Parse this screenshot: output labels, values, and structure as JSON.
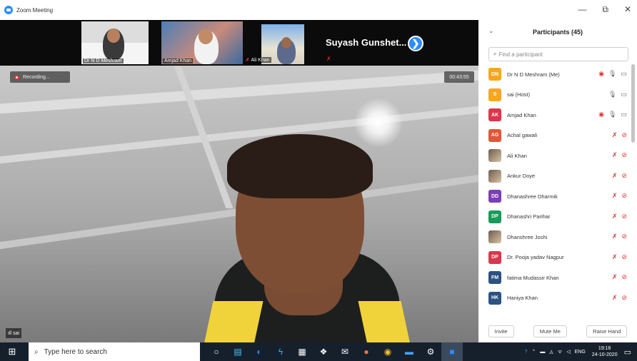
{
  "window": {
    "title": "Zoom Meeting",
    "controls": [
      "—",
      "⧉",
      "✕"
    ]
  },
  "thumbnails": [
    {
      "name": "Dr N D Meshram"
    },
    {
      "name": "Amjad Khan"
    },
    {
      "name": "Ali Khan"
    }
  ],
  "next_participant": "Suyash Gunshet...",
  "next_arrow": "❯",
  "recording": {
    "label": "Recording..."
  },
  "timer": "00:43:55",
  "active_speaker": {
    "name": "sai"
  },
  "panel": {
    "title": "Participants (45)",
    "search_placeholder": "Find a participant",
    "participants": [
      {
        "initials": "DN",
        "color": "#f5a623",
        "name": "Dr N D Meshram (Me)",
        "status": "rec-unmuted"
      },
      {
        "initials": "S",
        "color": "#f5a623",
        "name": "sai (Host)",
        "status": "unmuted"
      },
      {
        "initials": "AK",
        "color": "#d9374b",
        "name": "Amjad Khan",
        "status": "rec-unmuted"
      },
      {
        "initials": "AG",
        "color": "#e5553a",
        "name": "Achal gawali",
        "status": "muted"
      },
      {
        "initials": "",
        "color": "",
        "name": "Ali Khan",
        "status": "muted"
      },
      {
        "initials": "",
        "color": "",
        "name": "Ankur Doye",
        "status": "muted"
      },
      {
        "initials": "DD",
        "color": "#7b3fb5",
        "name": "Dhanashree Dharmik",
        "status": "muted"
      },
      {
        "initials": "DP",
        "color": "#1a9b5a",
        "name": "Dhanashri  Parihar",
        "status": "muted"
      },
      {
        "initials": "",
        "color": "",
        "name": "Dhanshree Joshi",
        "status": "muted"
      },
      {
        "initials": "DP",
        "color": "#d9374b",
        "name": "Dr. Pooja yadav Nagpur",
        "status": "muted"
      },
      {
        "initials": "FM",
        "color": "#2c5282",
        "name": "fatima Mudassir Khan",
        "status": "muted"
      },
      {
        "initials": "HK",
        "color": "#2c5282",
        "name": "Haniya Khan",
        "status": "muted"
      }
    ],
    "actions": [
      "Invite",
      "Mute Me",
      "Raise Hand"
    ]
  },
  "taskbar": {
    "search_placeholder": "Type here to search",
    "language": "ENG",
    "time": "19:16",
    "date": "24-10-2020"
  }
}
